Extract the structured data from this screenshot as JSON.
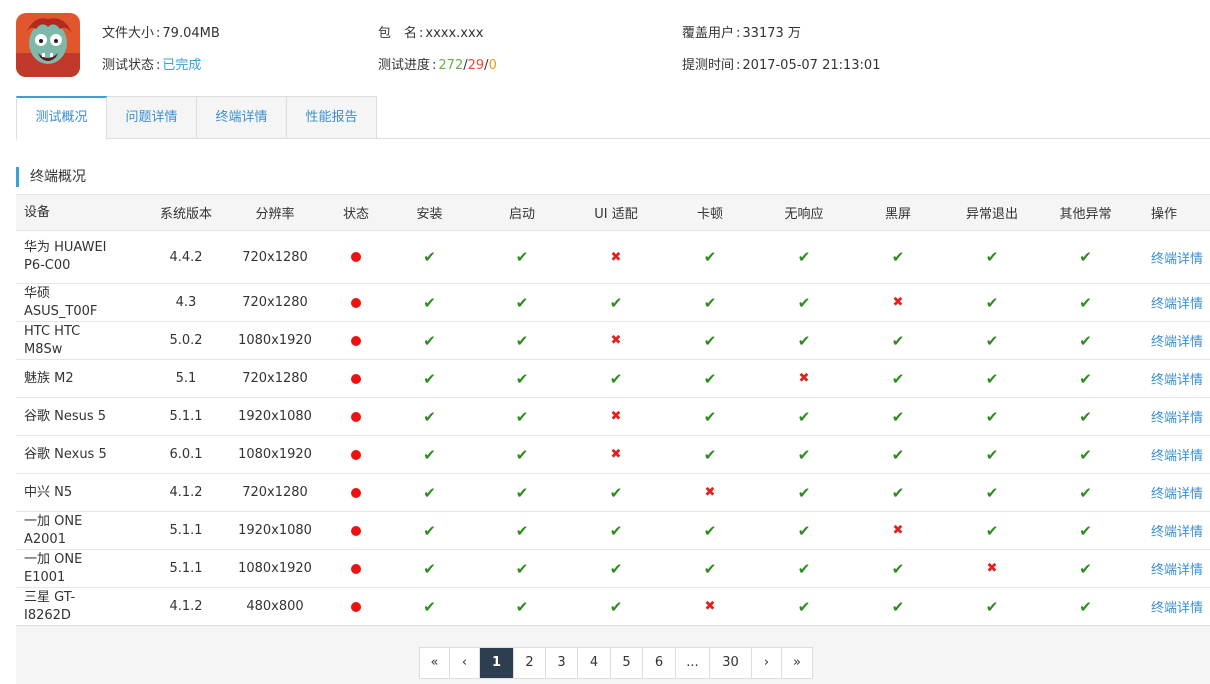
{
  "header": {
    "file_size_label": "文件大小",
    "file_size": "79.04MB",
    "package_label": "包　名",
    "package": "xxxx.xxx",
    "coverage_label": "覆盖用户",
    "coverage": "33173 万",
    "status_label": "测试状态",
    "status": "已完成",
    "progress_label": "测试进度",
    "progress_pass": "272",
    "progress_fail": "29",
    "progress_pending": "0",
    "submit_time_label": "提测时间",
    "submit_time": "2017-05-07 21:13:01"
  },
  "tabs": [
    "测试概况",
    "问题详情",
    "终端详情",
    "性能报告"
  ],
  "section_title": "终端概况",
  "table": {
    "columns": [
      "设备",
      "系统版本",
      "分辨率",
      "状态",
      "安装",
      "启动",
      "UI 适配",
      "卡顿",
      "无响应",
      "黑屏",
      "异常退出",
      "其他异常",
      "操作"
    ],
    "rows": [
      {
        "device": "华为 HUAWEI P6-C00",
        "os": "4.4.2",
        "res": "720x1280",
        "checks": [
          1,
          1,
          0,
          1,
          1,
          1,
          1,
          1
        ],
        "op": "终端详情"
      },
      {
        "device": "华硕 ASUS_T00F",
        "os": "4.3",
        "res": "720x1280",
        "checks": [
          1,
          1,
          1,
          1,
          1,
          0,
          1,
          1
        ],
        "op": "终端详情"
      },
      {
        "device": "HTC HTC M8Sw",
        "os": "5.0.2",
        "res": "1080x1920",
        "checks": [
          1,
          1,
          0,
          1,
          1,
          1,
          1,
          1
        ],
        "op": "终端详情"
      },
      {
        "device": "魅族 M2",
        "os": "5.1",
        "res": "720x1280",
        "checks": [
          1,
          1,
          1,
          1,
          0,
          1,
          1,
          1
        ],
        "op": "终端详情"
      },
      {
        "device": "谷歌 Nesus 5",
        "os": "5.1.1",
        "res": "1920x1080",
        "checks": [
          1,
          1,
          0,
          1,
          1,
          1,
          1,
          1
        ],
        "op": "终端详情"
      },
      {
        "device": "谷歌 Nexus 5",
        "os": "6.0.1",
        "res": "1080x1920",
        "checks": [
          1,
          1,
          0,
          1,
          1,
          1,
          1,
          1
        ],
        "op": "终端详情"
      },
      {
        "device": "中兴 N5",
        "os": "4.1.2",
        "res": "720x1280",
        "checks": [
          1,
          1,
          1,
          0,
          1,
          1,
          1,
          1
        ],
        "op": "终端详情"
      },
      {
        "device": "一加 ONE A2001",
        "os": "5.1.1",
        "res": "1920x1080",
        "checks": [
          1,
          1,
          1,
          1,
          1,
          0,
          1,
          1
        ],
        "op": "终端详情"
      },
      {
        "device": "一加 ONE E1001",
        "os": "5.1.1",
        "res": "1080x1920",
        "checks": [
          1,
          1,
          1,
          1,
          1,
          1,
          0,
          1
        ],
        "op": "终端详情"
      },
      {
        "device": "三星 GT-I8262D",
        "os": "4.1.2",
        "res": "480x800",
        "checks": [
          1,
          1,
          1,
          0,
          1,
          1,
          1,
          1
        ],
        "op": "终端详情"
      }
    ]
  },
  "icons": {
    "ok": "check-icon",
    "fail": "cross-icon",
    "status": "status-dot-icon"
  },
  "colors": {
    "accent": "#3aa0d8",
    "ok": "#2e8b1f",
    "fail": "#e61e1e",
    "status_dot": "#ee1111",
    "pager_active": "#2c3e50"
  },
  "pagination": {
    "items": [
      "«",
      "‹",
      "1",
      "2",
      "3",
      "4",
      "5",
      "6",
      "...",
      "30",
      "›",
      "»"
    ],
    "current": "1"
  }
}
